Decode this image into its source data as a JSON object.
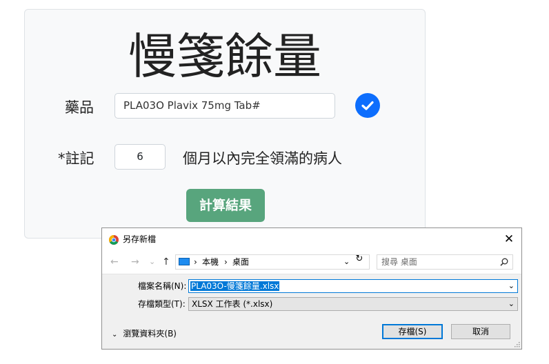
{
  "form": {
    "title": "慢箋餘量",
    "drug_label": "藥品",
    "drug_value": "PLA03O Plavix 75mg Tab#",
    "note_label": "*註記",
    "months_value": "6",
    "months_suffix": "個月以內完全領滿的病人",
    "calc_button": "計算結果"
  },
  "dialog": {
    "title": "另存新檔",
    "close": "✕",
    "nav": {
      "back": "←",
      "forward": "→",
      "recent": "⌄",
      "up": "↑"
    },
    "path": [
      "本機",
      "桌面"
    ],
    "path_sep": "›",
    "address_dropdown": "⌄",
    "refresh": "↻",
    "search_placeholder": "搜尋 桌面",
    "filename_label": "檔案名稱(N):",
    "filename_value": "PLA03O-慢箋餘量.xlsx",
    "filetype_label": "存檔類型(T):",
    "filetype_value": "XLSX 工作表 (*.xlsx)",
    "dropdown_glyph": "⌄",
    "browse_folders": "瀏覽資料夾(B)",
    "browse_chevron": "⌄",
    "save_button": "存檔(S)",
    "cancel_button": "取消"
  },
  "colors": {
    "check": "#0d6efd",
    "calc_button": "#58a57d",
    "selection": "#0078d7"
  },
  "icons": [
    "checkmark-icon",
    "chrome-icon",
    "computer-icon",
    "search-icon",
    "close-icon"
  ]
}
